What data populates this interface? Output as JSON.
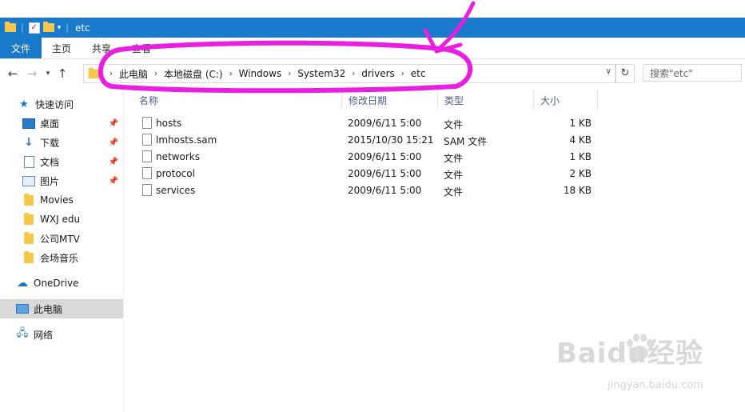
{
  "window": {
    "title": "etc"
  },
  "ribbon": {
    "tabs": [
      "文件",
      "主页",
      "共享",
      "查看"
    ]
  },
  "address": {
    "segments": [
      "此电脑",
      "本地磁盘 (C:)",
      "Windows",
      "System32",
      "drivers",
      "etc"
    ]
  },
  "search": {
    "placeholder": "搜索\"etc\""
  },
  "sidebar": {
    "quick_access": "快速访问",
    "items": [
      {
        "label": "桌面",
        "icon": "desktop-icon",
        "pinned": true
      },
      {
        "label": "下载",
        "icon": "download-icon",
        "pinned": true
      },
      {
        "label": "文档",
        "icon": "document-icon",
        "pinned": true
      },
      {
        "label": "图片",
        "icon": "pictures-icon",
        "pinned": true
      },
      {
        "label": "Movies",
        "icon": "folder-icon",
        "pinned": false
      },
      {
        "label": "WXJ edu",
        "icon": "folder-icon",
        "pinned": false
      },
      {
        "label": "公司MTV",
        "icon": "folder-icon",
        "pinned": false
      },
      {
        "label": "会场音乐",
        "icon": "folder-icon",
        "pinned": false
      }
    ],
    "onedrive": "OneDrive",
    "this_pc": "此电脑",
    "network": "网络"
  },
  "columns": {
    "name": "名称",
    "modified": "修改日期",
    "type": "类型",
    "size": "大小"
  },
  "files": [
    {
      "name": "hosts",
      "modified": "2009/6/11 5:00",
      "type": "文件",
      "size": "1 KB"
    },
    {
      "name": "lmhosts.sam",
      "modified": "2015/10/30 15:21",
      "type": "SAM 文件",
      "size": "4 KB"
    },
    {
      "name": "networks",
      "modified": "2009/6/11 5:00",
      "type": "文件",
      "size": "1 KB"
    },
    {
      "name": "protocol",
      "modified": "2009/6/11 5:00",
      "type": "文件",
      "size": "2 KB"
    },
    {
      "name": "services",
      "modified": "2009/6/11 5:00",
      "type": "文件",
      "size": "18 KB"
    }
  ],
  "watermark": {
    "brand": "Baidu经验",
    "url": "jingyan.baidu.com"
  },
  "colors": {
    "accent": "#1979ca",
    "annotation": "#ea1ee0"
  }
}
